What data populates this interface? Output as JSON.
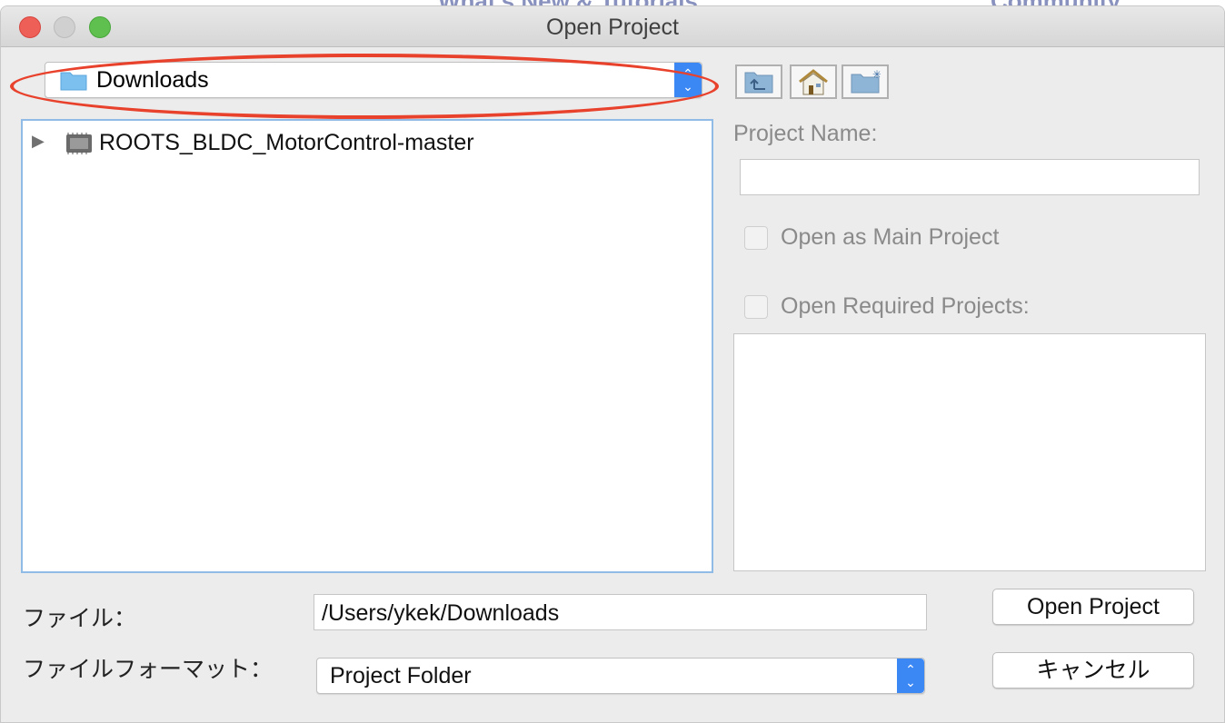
{
  "background": {
    "left_text": "What's New & Tutorials",
    "right_text": "Community"
  },
  "window": {
    "title": "Open Project"
  },
  "location_combo": {
    "value": "Downloads",
    "icon": "folder-icon"
  },
  "toolbar": {
    "up": "folder-up-icon",
    "home": "home-icon",
    "new_folder": "new-folder-icon"
  },
  "tree": {
    "items": [
      {
        "label": "ROOTS_BLDC_MotorControl-master",
        "icon": "project-chip-icon",
        "expanded": false
      }
    ]
  },
  "project_name": {
    "label": "Project Name:",
    "value": ""
  },
  "open_main": {
    "label": "Open as Main Project",
    "checked": false
  },
  "open_required": {
    "label": "Open Required Projects:",
    "checked": false
  },
  "file": {
    "label": "ファイル：",
    "value": "/Users/ykek/Downloads"
  },
  "format": {
    "label": "ファイルフォーマット：",
    "value": "Project Folder"
  },
  "buttons": {
    "open": "Open Project",
    "cancel": "キャンセル"
  },
  "colors": {
    "accent": "#3b88f5",
    "annotation": "#e8412c"
  }
}
